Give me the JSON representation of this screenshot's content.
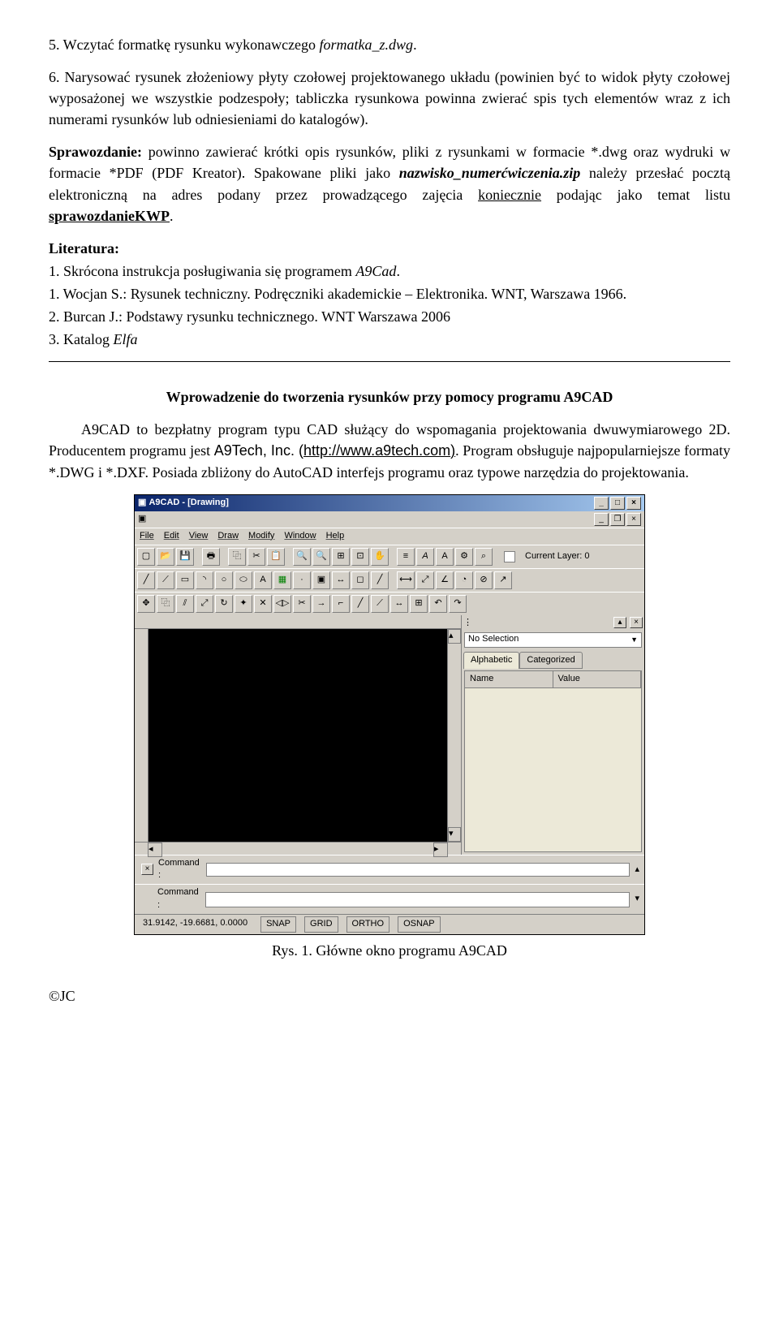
{
  "list5": "5. Wczytać formatkę rysunku wykonawczego ",
  "list5_italic": "formatka_z.dwg",
  "list5_end": ".",
  "list6": "6. Narysować rysunek złożeniowy płyty czołowej projektowanego układu (powinien być to widok płyty czołowej wyposażonej we wszystkie podzespoły; tabliczka rysunkowa powinna zwierać spis tych elementów wraz z ich numerami rysunków lub odniesieniami do katalogów).",
  "spraw_b": "Sprawozdanie:",
  "spraw_1": " powinno zawierać krótki opis rysunków, pliki z rysunkami w formacie *.dwg oraz wydruki w formacie *PDF (PDF Kreator). Spakowane pliki jako ",
  "spraw_i": "nazwisko_numerćwiczenia.zip",
  "spraw_2": " należy przesłać pocztą elektroniczną na adres podany przez prowadzącego zajęcia ",
  "spraw_u1": "koniecznie",
  "spraw_3": " podając jako temat listu ",
  "spraw_u2": "sprawozdanieKWP",
  "spraw_4": ".",
  "lit_h": "Literatura:",
  "lit1": "1. Skrócona instrukcja posługiwania się programem ",
  "lit1_i": "A9Cad",
  "lit1_e": ".",
  "lit2": "1.  Wocjan S.: Rysunek techniczny. Podręczniki akademickie – Elektronika. WNT, Warszawa 1966.",
  "lit3": "2.  Burcan J.: Podstawy rysunku technicznego. WNT Warszawa 2006",
  "lit4": "3. Katalog ",
  "lit4_i": "Elfa",
  "intro_h": "Wprowadzenie do tworzenia rysunków przy pomocy programu A9CAD",
  "intro_p1a": "A9CAD to bezpłatny program typu CAD służący do wspomagania projektowania dwuwymiarowego 2D. Producentem programu jest ",
  "intro_p1b": "A9Tech, Inc. (",
  "intro_url": "http://www.a9tech.com",
  "intro_p1c": ")",
  "intro_p1d": ". Program obsługuje najpopularniejsze formaty  *.DWG i *.DXF. Posiada zbliżony do AutoCAD interfejs programu oraz typowe narzędzia do projektowania.",
  "caption": "Rys. 1. Główne okno programu A9CAD",
  "copyright": "©JC",
  "cad": {
    "title": "A9CAD - [Drawing]",
    "menu": [
      "File",
      "Edit",
      "View",
      "Draw",
      "Modify",
      "Window",
      "Help"
    ],
    "layer_label": "Current Layer:",
    "layer_value": "0",
    "dropdown": "No Selection",
    "tab1": "Alphabetic",
    "tab2": "Categorized",
    "col1": "Name",
    "col2": "Value",
    "cmd": "Command :",
    "coords": "31.9142, -19.6681, 0.0000",
    "snap": "SNAP",
    "grid": "GRID",
    "ortho": "ORTHO",
    "osnap": "OSNAP"
  }
}
